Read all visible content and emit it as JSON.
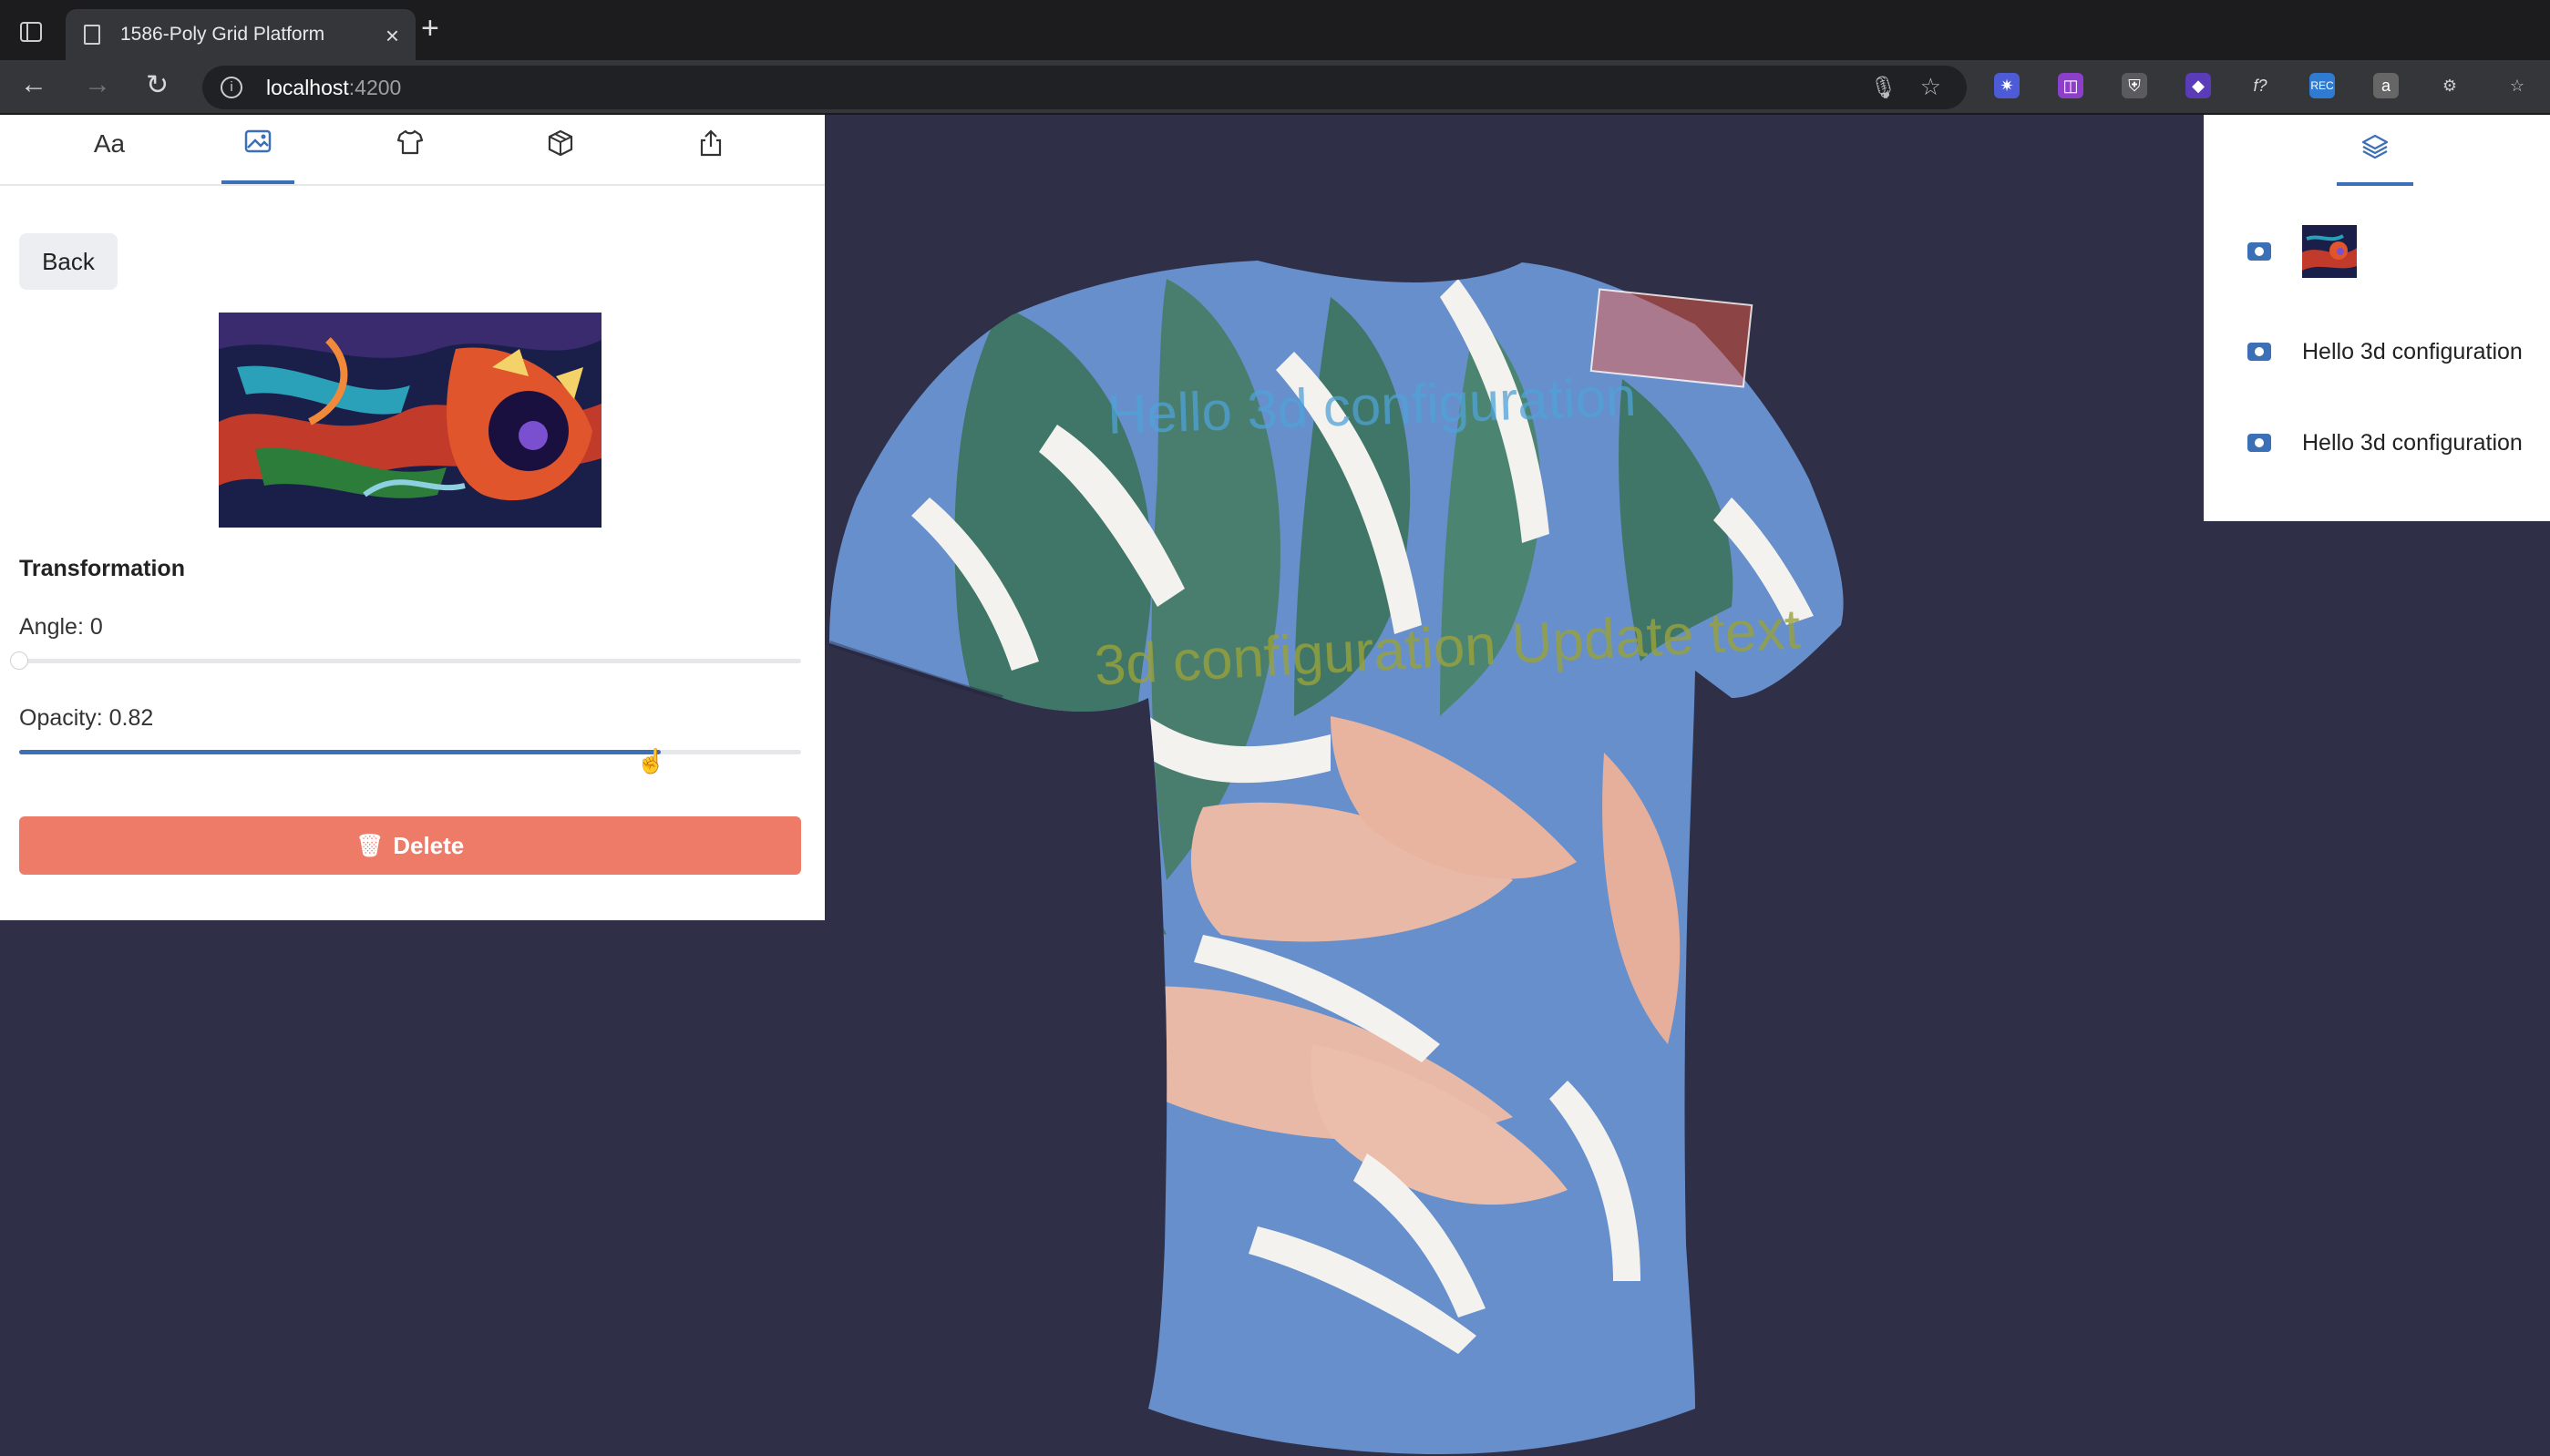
{
  "browser": {
    "tab_title": "1586-Poly Grid Platform",
    "new_tab": "+",
    "close": "×",
    "url_host": "localhost",
    "url_port": ":4200"
  },
  "left_panel": {
    "tabs": [
      {
        "label": "Aa",
        "icon": "text-icon"
      },
      {
        "label": "",
        "icon": "image-icon"
      },
      {
        "label": "",
        "icon": "shirt-icon"
      },
      {
        "label": "",
        "icon": "box-icon"
      },
      {
        "label": "",
        "icon": "share-icon"
      }
    ],
    "back_label": "Back",
    "section_title": "Transformation",
    "angle_label": "Angle: 0",
    "angle_value": 0,
    "opacity_label": "Opacity: 0.82",
    "opacity_value": 0.82,
    "delete_label": "Delete"
  },
  "right_panel": {
    "layers": [
      {
        "type": "image",
        "text": ""
      },
      {
        "type": "text",
        "text": "Hello 3d configuration"
      },
      {
        "type": "text",
        "text": "Hello 3d configuration"
      }
    ]
  },
  "shirt": {
    "text_top": "Hello 3d configuration",
    "text_middle": "3d configuration Update text"
  },
  "colors": {
    "accent": "#3b6fb6",
    "delete": "#ee7b68",
    "viewport_bg": "#2f2f48"
  }
}
